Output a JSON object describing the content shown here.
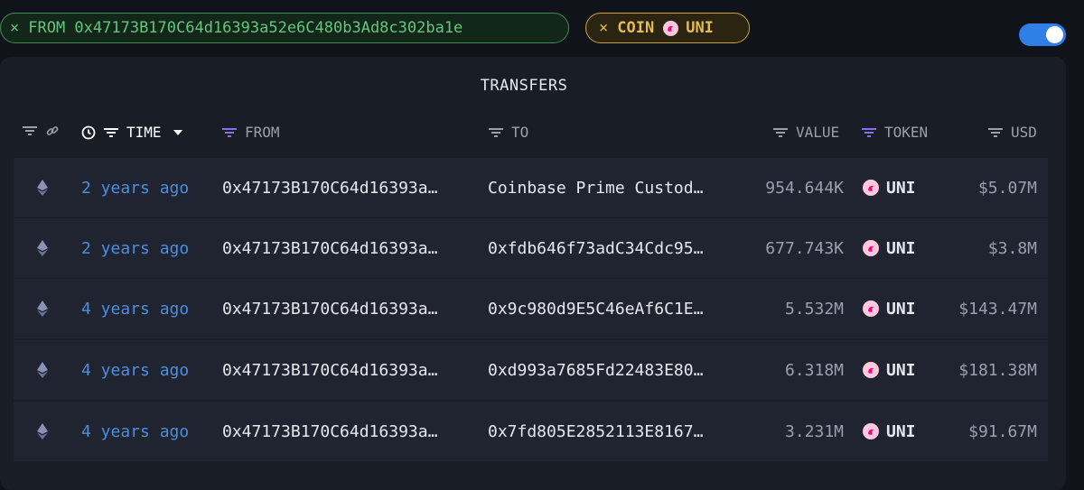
{
  "filters": {
    "from_chip": {
      "close": "×",
      "label": "FROM 0x47173B170C64d16393a52e6C480b3Ad8c302ba1e"
    },
    "coin_chip": {
      "close": "×",
      "label": "COIN",
      "token": "UNI"
    }
  },
  "toggle": {
    "on": true,
    "color": "#2f7fe6"
  },
  "panel": {
    "title": "TRANSFERS",
    "columns": {
      "time": "TIME",
      "from": "FROM",
      "to": "TO",
      "value": "VALUE",
      "token": "TOKEN",
      "usd": "USD"
    },
    "rows": [
      {
        "chain_icon": "ethereum-icon",
        "time": "2 years ago",
        "from": "0x47173B170C64d16393a…",
        "to": "Coinbase Prime Custod…",
        "value": "954.644K",
        "token": "UNI",
        "usd": "$5.07M"
      },
      {
        "chain_icon": "ethereum-icon",
        "time": "2 years ago",
        "from": "0x47173B170C64d16393a…",
        "to": "0xfdb646f73adC34Cdc95…",
        "value": "677.743K",
        "token": "UNI",
        "usd": "$3.8M"
      },
      {
        "chain_icon": "ethereum-icon",
        "time": "4 years ago",
        "from": "0x47173B170C64d16393a…",
        "to": "0x9c980d9E5C46eAf6C1E…",
        "value": "5.532M",
        "token": "UNI",
        "usd": "$143.47M"
      },
      {
        "chain_icon": "ethereum-icon",
        "time": "4 years ago",
        "from": "0x47173B170C64d16393a…",
        "to": "0xd993a7685Fd22483E80…",
        "value": "6.318M",
        "token": "UNI",
        "usd": "$181.38M"
      },
      {
        "chain_icon": "ethereum-icon",
        "time": "4 years ago",
        "from": "0x47173B170C64d16393a…",
        "to": "0x7fd805E2852113E8167…",
        "value": "3.231M",
        "token": "UNI",
        "usd": "$91.67M"
      }
    ]
  },
  "colors": {
    "accent_blue": "#4c8fe0",
    "filter_green": "#64c77a",
    "filter_gold": "#e3bc55",
    "filter_purple": "#8b6fe6",
    "uni_pink": "#ff007a"
  }
}
